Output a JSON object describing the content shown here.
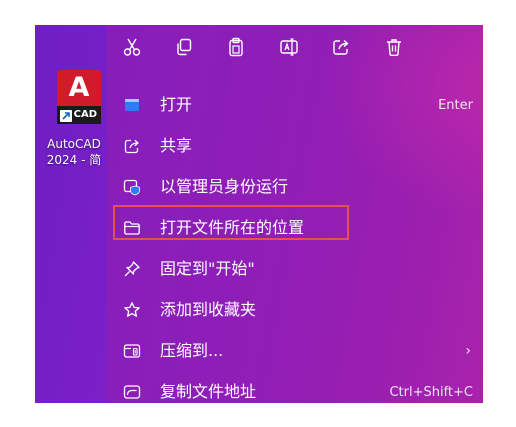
{
  "desktop": {
    "app_tile_letter": "A",
    "app_tile_band": "CAD",
    "label_line1": "AutoCAD",
    "label_line2": "2024 - 简",
    "tile_color": "#d11a2a",
    "icons": [
      "autocad-logo-icon",
      "shortcut-arrow-icon"
    ]
  },
  "context_menu": {
    "toolbar": [
      {
        "name": "cut",
        "icon": "scissors-icon"
      },
      {
        "name": "copy",
        "icon": "copy-icon"
      },
      {
        "name": "paste",
        "icon": "clipboard-icon"
      },
      {
        "name": "rename",
        "icon": "rename-icon"
      },
      {
        "name": "share",
        "icon": "share-icon"
      },
      {
        "name": "delete",
        "icon": "trash-icon"
      }
    ],
    "items": [
      {
        "label": "打开",
        "shortcut": "Enter",
        "icon": "app-window-icon"
      },
      {
        "label": "共享",
        "shortcut": "",
        "icon": "share-icon"
      },
      {
        "label": "以管理员身份运行",
        "shortcut": "",
        "icon": "shield-window-icon"
      },
      {
        "label": "打开文件所在的位置",
        "shortcut": "",
        "icon": "folder-icon"
      },
      {
        "label": "固定到\"开始\"",
        "shortcut": "",
        "icon": "pin-icon"
      },
      {
        "label": "添加到收藏夹",
        "shortcut": "",
        "icon": "star-icon"
      },
      {
        "label": "压缩到...",
        "shortcut": "",
        "icon": "zip-folder-icon",
        "submenu": "›"
      },
      {
        "label": "复制文件地址",
        "shortcut": "Ctrl+Shift+C",
        "icon": "path-copy-icon"
      }
    ],
    "highlighted_item": "打开文件所在的位置",
    "highlight_color": "#e8504e"
  }
}
